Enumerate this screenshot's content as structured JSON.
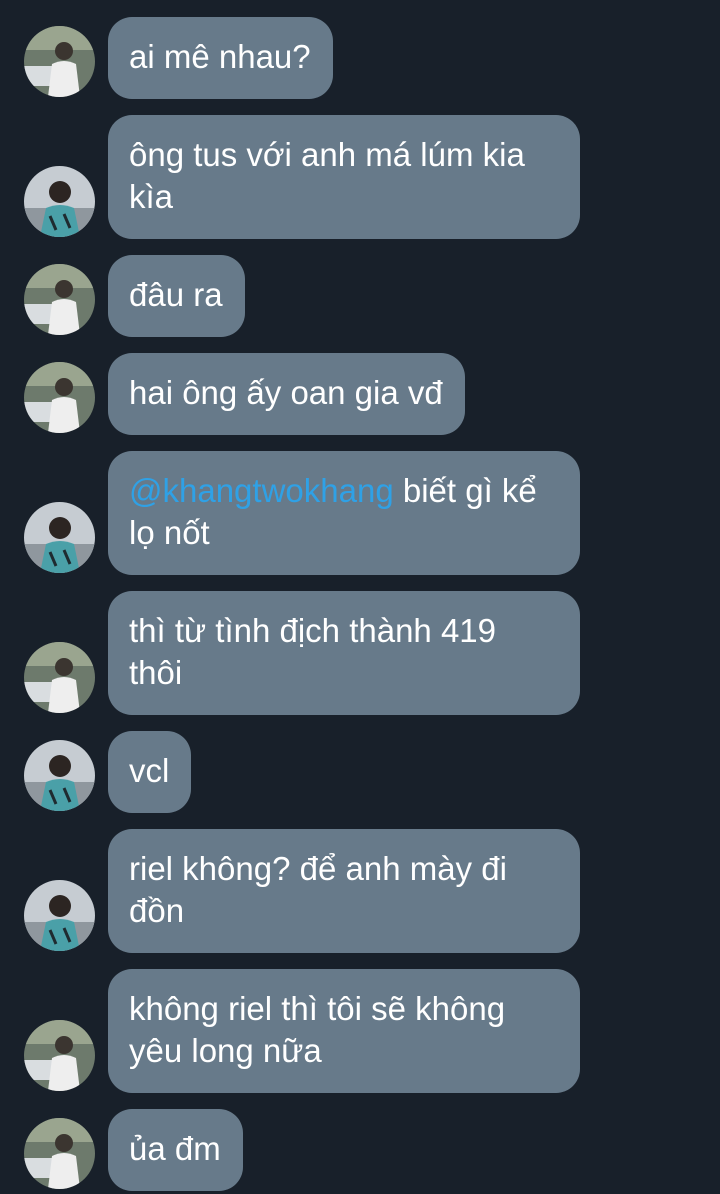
{
  "conversation": {
    "messages": [
      {
        "sender": "user-a",
        "text": "ai mê nhau?"
      },
      {
        "sender": "user-b",
        "text": "ông tus với anh má lúm kia kìa"
      },
      {
        "sender": "user-a",
        "text": "đâu ra"
      },
      {
        "sender": "user-a",
        "text": "hai ông ấy oan gia vđ"
      },
      {
        "sender": "user-b",
        "mention": "@khangtwokhang",
        "text": " biết gì kể lọ nốt"
      },
      {
        "sender": "user-a",
        "text": "thì từ tình địch thành 419 thôi"
      },
      {
        "sender": "user-b",
        "text": "vcl"
      },
      {
        "sender": "user-b",
        "text": "riel không? để anh mày đi đồn"
      },
      {
        "sender": "user-a",
        "text": "không riel thì tôi sẽ không yêu long nữa"
      },
      {
        "sender": "user-a",
        "text": "ủa đm"
      }
    ]
  },
  "colors": {
    "background": "#18202a",
    "bubble": "#677a8a",
    "bubble_text": "#ffffff",
    "mention": "#2fa1e6"
  }
}
